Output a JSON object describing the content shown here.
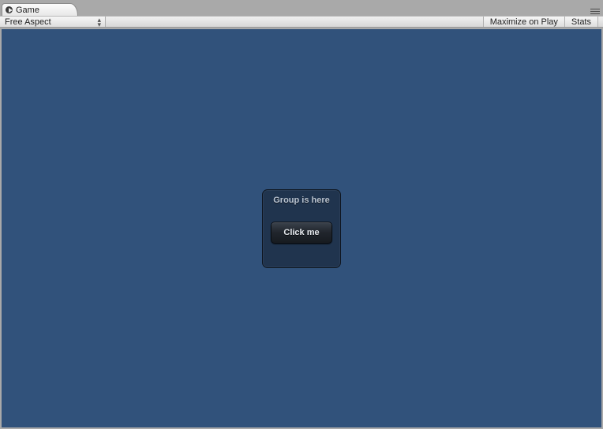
{
  "tab": {
    "title": "Game"
  },
  "toolbar": {
    "aspect_label": "Free Aspect",
    "maximize_label": "Maximize on Play",
    "stats_label": "Stats"
  },
  "gui": {
    "group_title": "Group is here",
    "button_label": "Click me"
  },
  "colors": {
    "viewport_bg": "#31527b"
  }
}
